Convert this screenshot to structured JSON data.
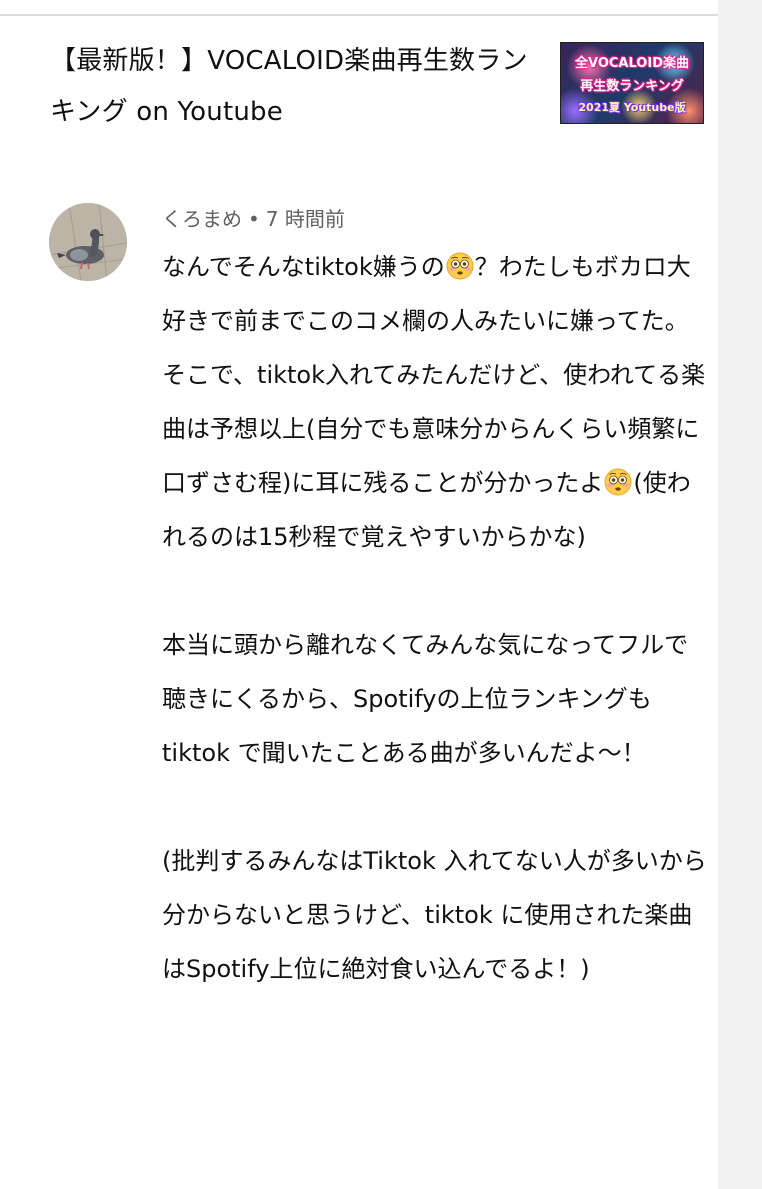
{
  "video": {
    "title": "【最新版！】VOCALOID楽曲再生数ランキング on Youtube",
    "thumbnail_lines": [
      "全VOCALOID楽曲",
      "再生数ランキング",
      "2021夏 Youtube版"
    ]
  },
  "comment": {
    "author": "くろまめ",
    "separator": "•",
    "time": "7 時間前",
    "paragraphs": [
      [
        "なんでそんなtiktok嫌うの",
        {
          "emoji": "flushed-face"
        },
        "？わたしもボカロ大好きで前までこのコメ欄の人みたいに嫌ってた。"
      ],
      [
        "そこで、tiktok入れてみたんだけど、使われてる楽曲は予想以上(自分でも意味分からんくらい頻繁に口ずさむ程)に耳に残ることが分かったよ",
        {
          "emoji": "flushed-face"
        },
        "(使われるのは15秒程で覚えやすいからかな)"
      ],
      [
        "本当に頭から離れなくてみんな気になってフルで聴きにくるから、Spotifyの上位ランキングもtiktok で聞いたことある曲が多いんだよ〜！"
      ],
      [
        "(批判するみんなはTiktok 入れてない人が多いから分からないと思うけど、tiktok に使用された楽曲はSpotify上位に絶対食い込んでるよ！)"
      ]
    ]
  },
  "colors": {
    "background": "#f1f1f1",
    "card": "#ffffff",
    "meta_text": "#606060",
    "body_text": "#111111",
    "divider": "#dcdcdc"
  }
}
